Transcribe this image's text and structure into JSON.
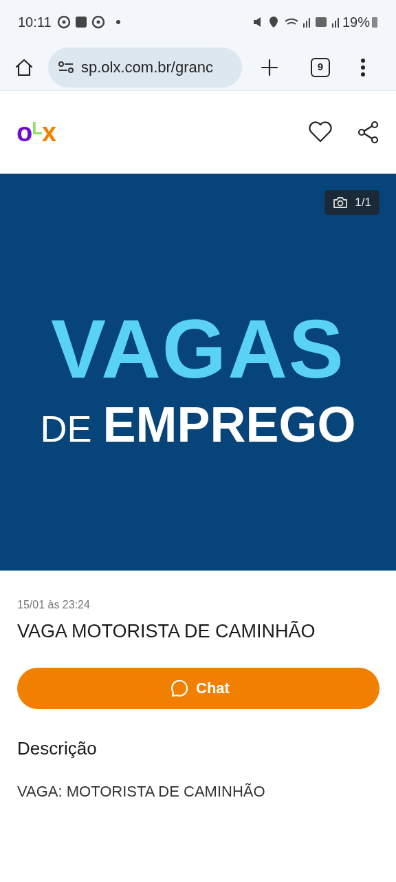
{
  "status_bar": {
    "time": "10:11",
    "battery": "19%"
  },
  "browser": {
    "url": "sp.olx.com.br/granc",
    "tab_count": "9"
  },
  "header": {
    "logo": [
      {
        "letter": "o",
        "color": "#6e0ad6"
      },
      {
        "letter": "L",
        "color": "#8ce563"
      },
      {
        "letter": "x",
        "color": "#f28000"
      }
    ]
  },
  "gallery": {
    "counter": "1/1",
    "image_text": [
      "VAGAS",
      "DE",
      "EMPREGO"
    ]
  },
  "ad": {
    "date": "15/01 às 23:24",
    "title": "VAGA MOTORISTA DE CAMINHÃO",
    "chat_button": "Chat",
    "description_heading": "Descrição",
    "description": "VAGA: MOTORISTA DE CAMINHÃO"
  }
}
